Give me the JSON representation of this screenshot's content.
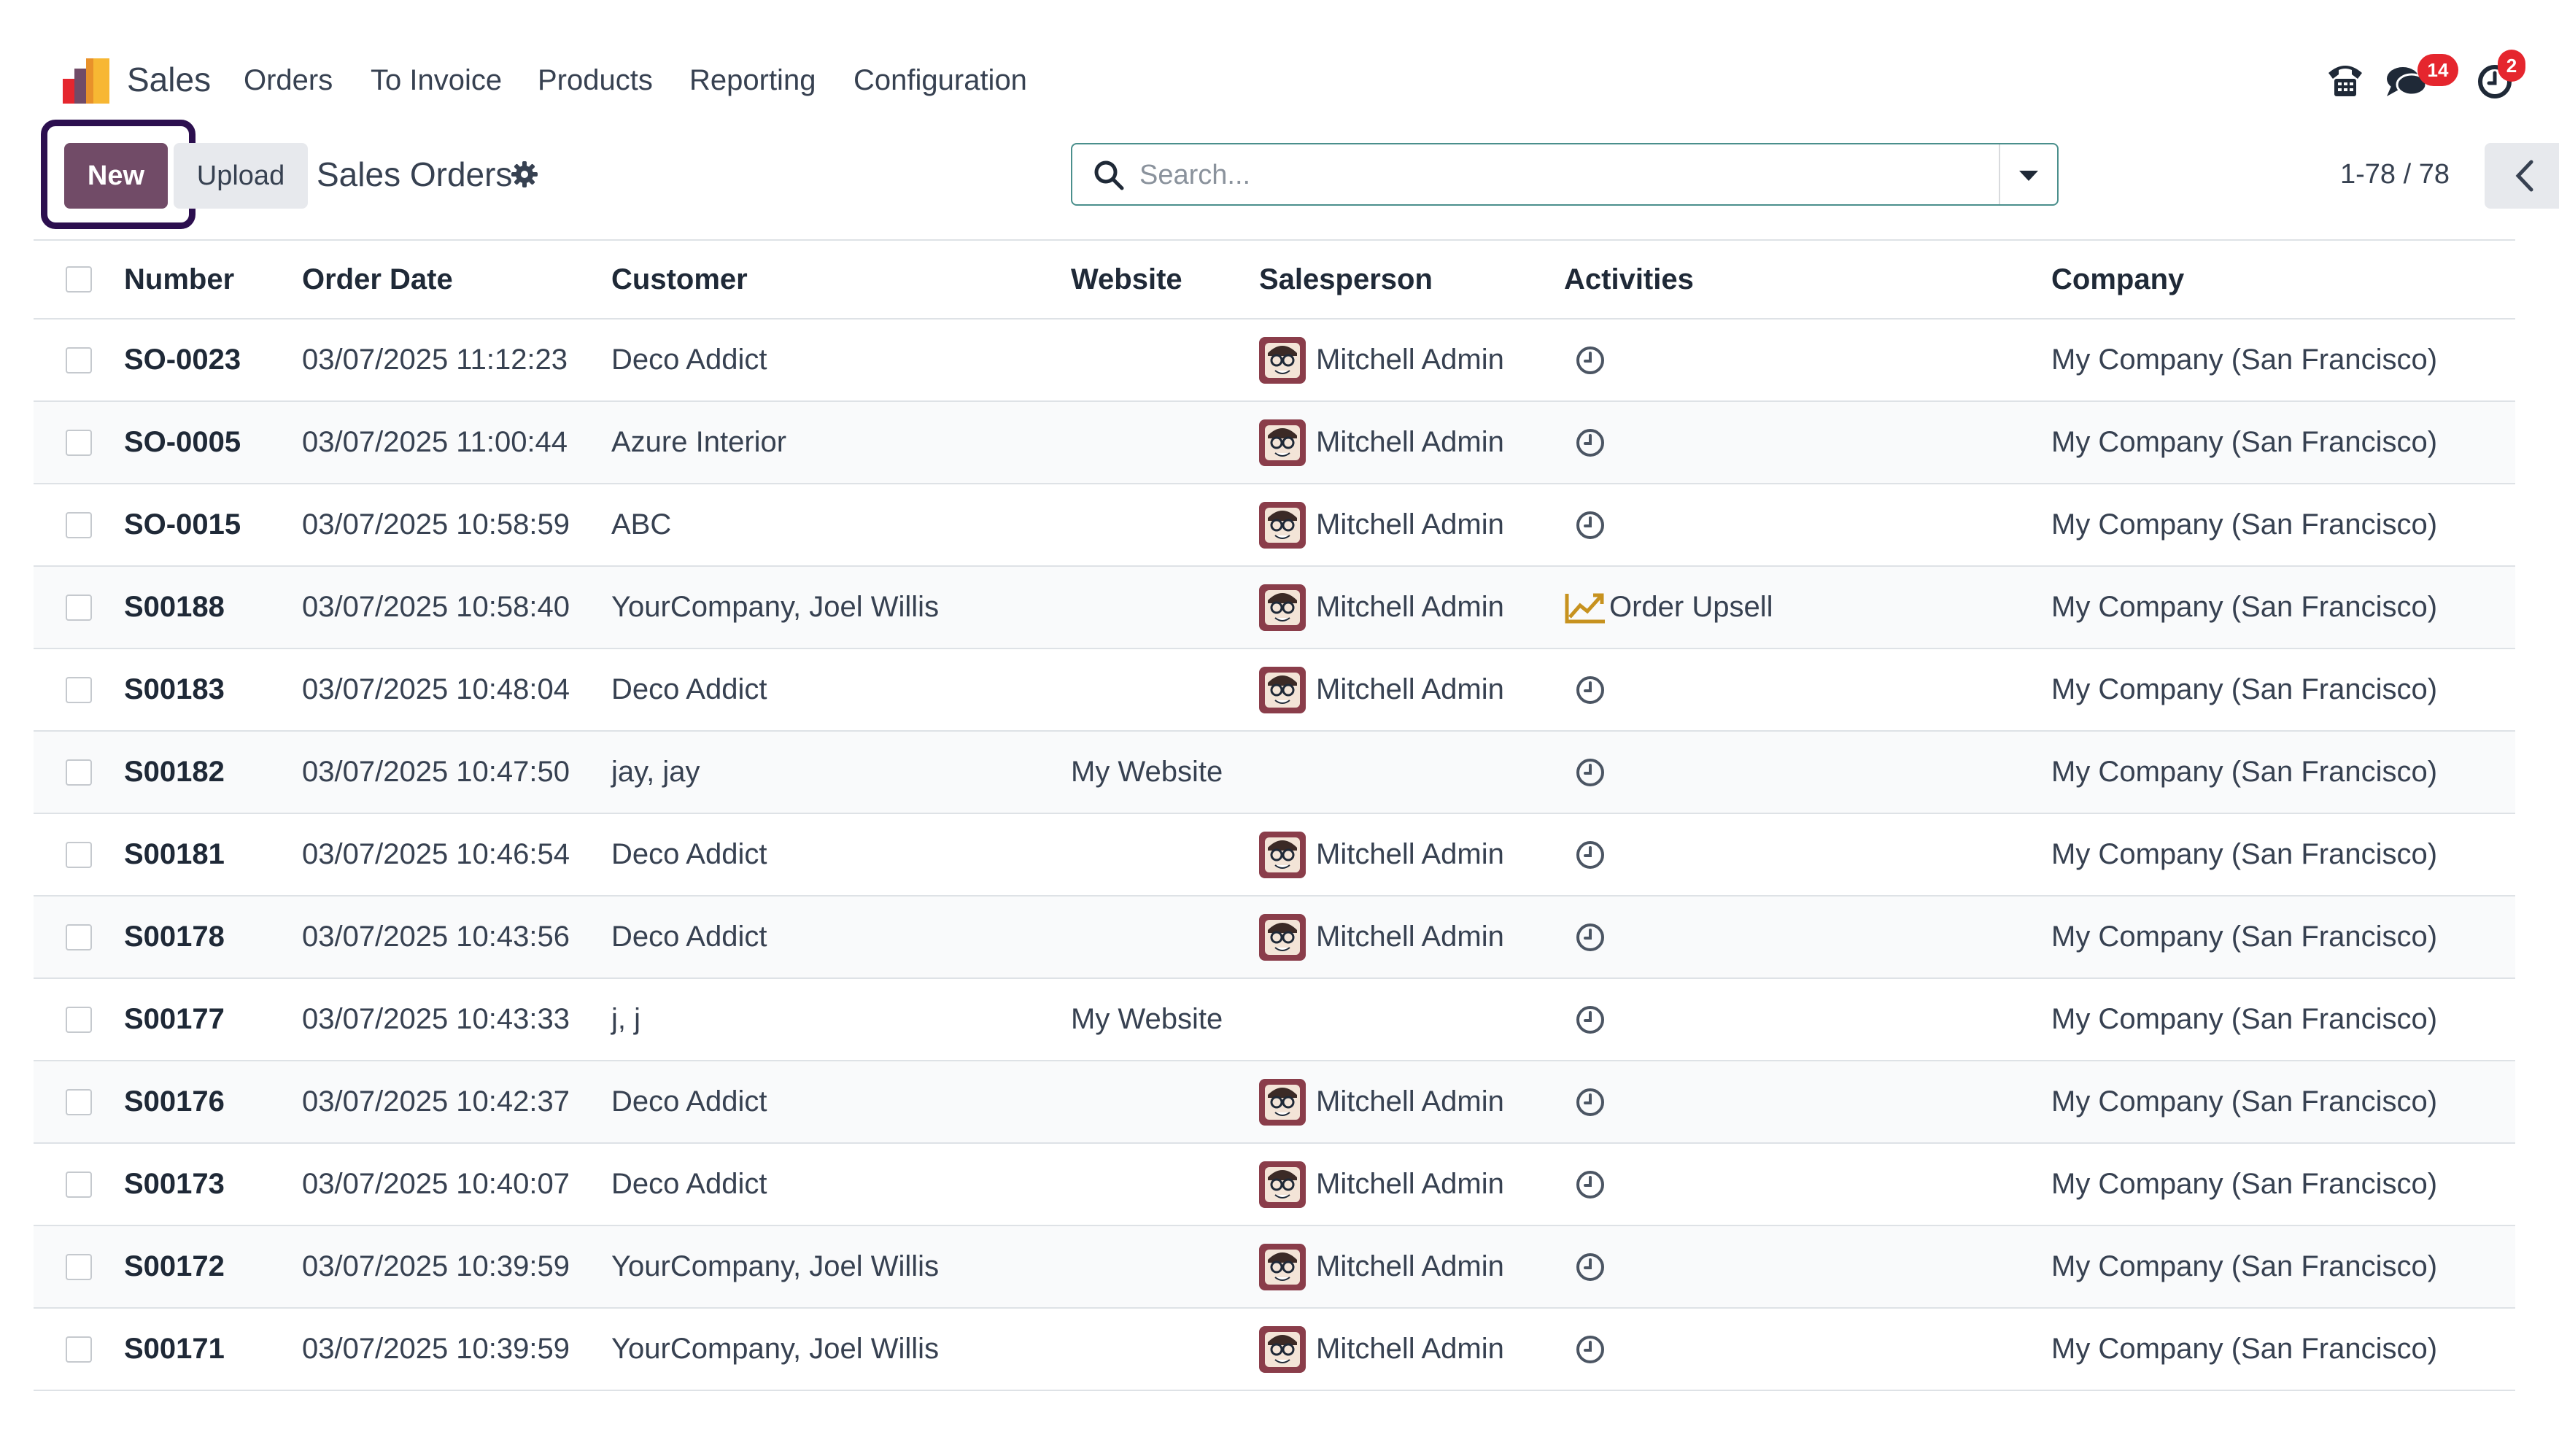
{
  "nav": {
    "app_name": "Sales",
    "menu": [
      "Orders",
      "To Invoice",
      "Products",
      "Reporting",
      "Configuration"
    ],
    "messages_badge": "14",
    "activities_badge": "2"
  },
  "control": {
    "new_label": "New",
    "upload_label": "Upload",
    "title": "Sales Orders",
    "search_placeholder": "Search...",
    "pager": "1-78 / 78"
  },
  "table": {
    "columns": [
      "Number",
      "Order Date",
      "Customer",
      "Website",
      "Salesperson",
      "Activities",
      "Company"
    ],
    "rows": [
      {
        "number": "SO-0023",
        "date": "03/07/2025 11:12:23",
        "customer": "Deco Addict",
        "website": "",
        "salesperson": "Mitchell Admin",
        "activity": "",
        "company": "My Company (San Francisco)"
      },
      {
        "number": "SO-0005",
        "date": "03/07/2025 11:00:44",
        "customer": "Azure Interior",
        "website": "",
        "salesperson": "Mitchell Admin",
        "activity": "",
        "company": "My Company (San Francisco)"
      },
      {
        "number": "SO-0015",
        "date": "03/07/2025 10:58:59",
        "customer": "ABC",
        "website": "",
        "salesperson": "Mitchell Admin",
        "activity": "",
        "company": "My Company (San Francisco)"
      },
      {
        "number": "S00188",
        "date": "03/07/2025 10:58:40",
        "customer": "YourCompany, Joel Willis",
        "website": "",
        "salesperson": "Mitchell Admin",
        "activity": "Order Upsell",
        "company": "My Company (San Francisco)"
      },
      {
        "number": "S00183",
        "date": "03/07/2025 10:48:04",
        "customer": "Deco Addict",
        "website": "",
        "salesperson": "Mitchell Admin",
        "activity": "",
        "company": "My Company (San Francisco)"
      },
      {
        "number": "S00182",
        "date": "03/07/2025 10:47:50",
        "customer": "jay, jay",
        "website": "My Website",
        "salesperson": "",
        "activity": "",
        "company": "My Company (San Francisco)"
      },
      {
        "number": "S00181",
        "date": "03/07/2025 10:46:54",
        "customer": "Deco Addict",
        "website": "",
        "salesperson": "Mitchell Admin",
        "activity": "",
        "company": "My Company (San Francisco)"
      },
      {
        "number": "S00178",
        "date": "03/07/2025 10:43:56",
        "customer": "Deco Addict",
        "website": "",
        "salesperson": "Mitchell Admin",
        "activity": "",
        "company": "My Company (San Francisco)"
      },
      {
        "number": "S00177",
        "date": "03/07/2025 10:43:33",
        "customer": "j, j",
        "website": "My Website",
        "salesperson": "",
        "activity": "",
        "company": "My Company (San Francisco)"
      },
      {
        "number": "S00176",
        "date": "03/07/2025 10:42:37",
        "customer": "Deco Addict",
        "website": "",
        "salesperson": "Mitchell Admin",
        "activity": "",
        "company": "My Company (San Francisco)"
      },
      {
        "number": "S00173",
        "date": "03/07/2025 10:40:07",
        "customer": "Deco Addict",
        "website": "",
        "salesperson": "Mitchell Admin",
        "activity": "",
        "company": "My Company (San Francisco)"
      },
      {
        "number": "S00172",
        "date": "03/07/2025 10:39:59",
        "customer": "YourCompany, Joel Willis",
        "website": "",
        "salesperson": "Mitchell Admin",
        "activity": "",
        "company": "My Company (San Francisco)"
      },
      {
        "number": "S00171",
        "date": "03/07/2025 10:39:59",
        "customer": "YourCompany, Joel Willis",
        "website": "",
        "salesperson": "Mitchell Admin",
        "activity": "",
        "company": "My Company (San Francisco)"
      }
    ]
  },
  "colors": {
    "primary": "#714b67",
    "highlight": "#2c0f4f",
    "badge": "#e5262e",
    "upsell": "#c7921f"
  }
}
